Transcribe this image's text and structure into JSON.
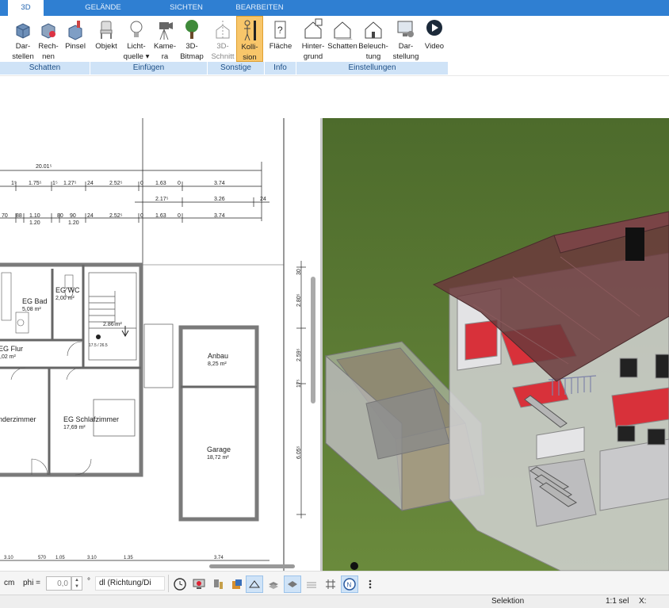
{
  "tabs": [
    "3D",
    "GELÄNDE",
    "SICHTEN",
    "BEARBEITEN"
  ],
  "ribbon": {
    "buttons": [
      {
        "label1": "Dar-",
        "label2": "stellen"
      },
      {
        "label1": "Rech-",
        "label2": "nen"
      },
      {
        "label1": "Pinsel",
        "label2": ""
      },
      {
        "label1": "Objekt",
        "label2": ""
      },
      {
        "label1": "Licht-",
        "label2": "quelle ▾"
      },
      {
        "label1": "Kame-",
        "label2": "ra"
      },
      {
        "label1": "3D-",
        "label2": "Bitmap"
      },
      {
        "label1": "3D-",
        "label2": "Schnitt"
      },
      {
        "label1": "Kolli-",
        "label2": "sion"
      },
      {
        "label1": "Fläche",
        "label2": ""
      },
      {
        "label1": "Hinter-",
        "label2": "grund"
      },
      {
        "label1": "Schatten",
        "label2": ""
      },
      {
        "label1": "Beleuch-",
        "label2": "tung"
      },
      {
        "label1": "Dar-",
        "label2": "stellung"
      },
      {
        "label1": "Video",
        "label2": ""
      }
    ],
    "groups": [
      "Schatten",
      "Einfügen",
      "Sonstige",
      "Info",
      "Einstellungen"
    ]
  },
  "plan": {
    "dims_row1": [
      "20.01⁵",
      "1⁵",
      "1.75⁵",
      "1⁵",
      "1.27⁵",
      "24",
      "2.52⁵",
      "0",
      "1.63",
      "0",
      "3.74"
    ],
    "dims_row2": [
      "2.17⁵",
      "3.26",
      "24"
    ],
    "dims_row3": [
      "70",
      "88",
      "1.10",
      "1.20",
      "80",
      "90",
      "1.20",
      "24",
      "2.52⁵",
      "0",
      "1.63",
      "0",
      "3.74"
    ],
    "dims_bottom": [
      "3.10",
      "1.35",
      "3.10",
      "3.74",
      "570",
      "1.05"
    ],
    "vdims": [
      "2.80⁵",
      "2.59⁵",
      "6.05⁵",
      "30",
      "17⁵"
    ],
    "rooms": [
      {
        "name": "EG Bad",
        "area": "5,08 m²"
      },
      {
        "name": "EG WC",
        "area": "2,00 m²"
      },
      {
        "name": "EG Flur",
        "area": ",02 m²"
      },
      {
        "name": "nderzimmer",
        "area": ""
      },
      {
        "name": "EG Schlafzimmer",
        "area": "17,69 m²"
      },
      {
        "name": "Anbau",
        "area": "8,25 m²"
      },
      {
        "name": "Garage",
        "area": "18,72 m²"
      }
    ],
    "stair_label": "2.86 m²",
    "stair_sub": "17.5 / 26.5"
  },
  "toolbar": {
    "unit": "cm",
    "phi_label": "phi =",
    "phi_value": "0,0",
    "degree": "°",
    "direction_value": "dl (Richtung/Di"
  },
  "status": {
    "mode": "Selektion",
    "scale": "1:1 sel",
    "coord": "X:"
  },
  "colors": {
    "tabbar": "#2f7fd2",
    "group_label_bg": "#cfe3f7",
    "active_button": "#f8c66a",
    "roof": "#6b3a3c",
    "floor_red": "#d8313a",
    "grass": "#5c7a35"
  }
}
